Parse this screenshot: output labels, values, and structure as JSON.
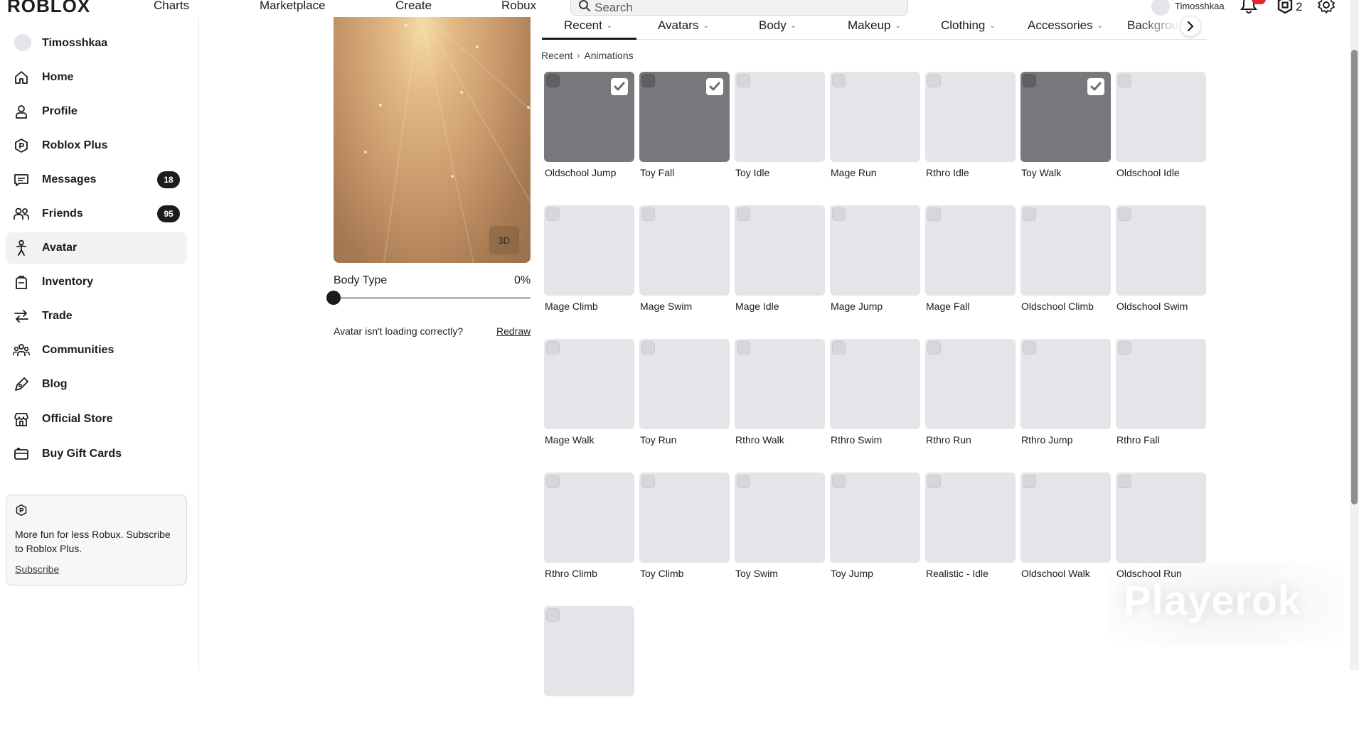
{
  "topbar": {
    "logo": "ROBLOX",
    "nav": [
      "Charts",
      "Marketplace",
      "Create",
      "Robux"
    ],
    "search_placeholder": "Search",
    "username": "Timosshkaa",
    "robux_count": "2"
  },
  "sidebar": {
    "username": "Timosshkaa",
    "items": [
      {
        "label": "Home",
        "icon": "home-icon"
      },
      {
        "label": "Profile",
        "icon": "profile-icon"
      },
      {
        "label": "Roblox Plus",
        "icon": "roblox-plus-icon"
      },
      {
        "label": "Messages",
        "icon": "messages-icon",
        "badge": "18"
      },
      {
        "label": "Friends",
        "icon": "friends-icon",
        "badge": "95"
      },
      {
        "label": "Avatar",
        "icon": "avatar-icon",
        "active": true
      },
      {
        "label": "Inventory",
        "icon": "inventory-icon"
      },
      {
        "label": "Trade",
        "icon": "trade-icon"
      },
      {
        "label": "Communities",
        "icon": "communities-icon"
      },
      {
        "label": "Blog",
        "icon": "blog-icon"
      },
      {
        "label": "Official Store",
        "icon": "store-icon"
      },
      {
        "label": "Buy Gift Cards",
        "icon": "gift-card-icon"
      }
    ],
    "promo": {
      "text": "More fun for less Robux. Subscribe to Roblox Plus.",
      "link": "Subscribe"
    }
  },
  "preview": {
    "button_3d": "3D",
    "body_type_label": "Body Type",
    "body_type_value": "0%",
    "body_type_fraction": 0,
    "loading_text": "Avatar isn't loading correctly?",
    "redraw": "Redraw"
  },
  "tabs": [
    "Recent",
    "Avatars",
    "Body",
    "Makeup",
    "Clothing",
    "Accessories",
    "Backgroun"
  ],
  "breadcrumb": [
    "Recent",
    "Animations"
  ],
  "items": [
    {
      "name": "Oldschool Jump",
      "selected": true
    },
    {
      "name": "Toy Fall",
      "selected": true
    },
    {
      "name": "Toy Idle",
      "selected": false
    },
    {
      "name": "Mage Run",
      "selected": false
    },
    {
      "name": "Rthro Idle",
      "selected": false
    },
    {
      "name": "Toy Walk",
      "selected": true
    },
    {
      "name": "Oldschool Idle",
      "selected": false
    },
    {
      "name": "Mage Climb",
      "selected": false
    },
    {
      "name": "Mage Swim",
      "selected": false
    },
    {
      "name": "Mage Idle",
      "selected": false
    },
    {
      "name": "Mage Jump",
      "selected": false
    },
    {
      "name": "Mage Fall",
      "selected": false
    },
    {
      "name": "Oldschool Climb",
      "selected": false
    },
    {
      "name": "Oldschool Swim",
      "selected": false
    },
    {
      "name": "Mage Walk",
      "selected": false
    },
    {
      "name": "Toy Run",
      "selected": false
    },
    {
      "name": "Rthro Walk",
      "selected": false
    },
    {
      "name": "Rthro Swim",
      "selected": false
    },
    {
      "name": "Rthro Run",
      "selected": false
    },
    {
      "name": "Rthro Jump",
      "selected": false
    },
    {
      "name": "Rthro Fall",
      "selected": false
    },
    {
      "name": "Rthro Climb",
      "selected": false
    },
    {
      "name": "Toy Climb",
      "selected": false
    },
    {
      "name": "Toy Swim",
      "selected": false
    },
    {
      "name": "Toy Jump",
      "selected": false
    },
    {
      "name": "Realistic - Idle",
      "selected": false
    },
    {
      "name": "Oldschool Walk",
      "selected": false
    },
    {
      "name": "Oldschool Run",
      "selected": false
    },
    {
      "name": "",
      "selected": false
    }
  ],
  "watermark": "Playerok",
  "colors": {
    "text": "#1b1c1e",
    "thumb": "#e4e5e9",
    "thumb_selected": "#77787c",
    "badge": "#1b1c1e",
    "notification": "#e5262d"
  }
}
